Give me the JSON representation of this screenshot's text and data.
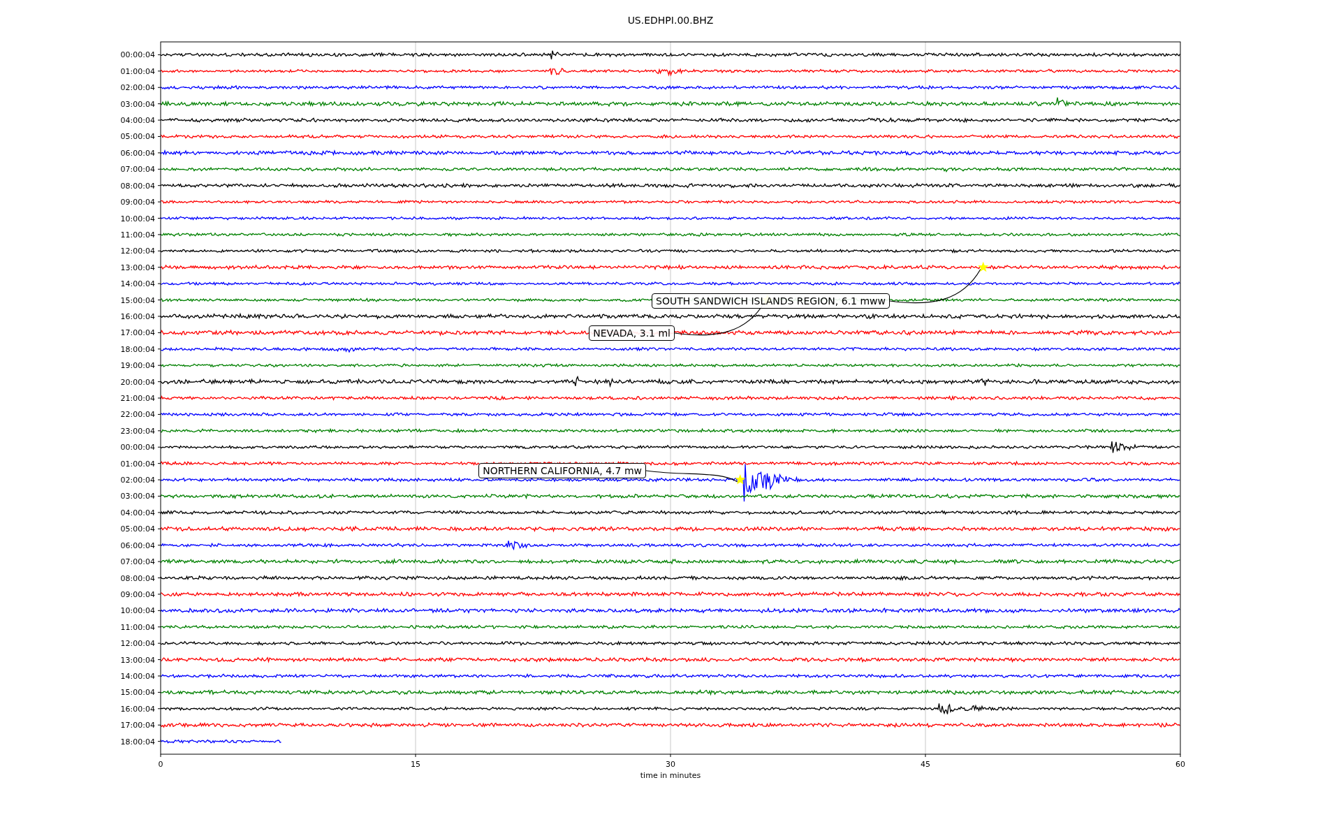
{
  "title": "US.EDHPI.00.BHZ",
  "xlabel": "time in minutes",
  "xticks": [
    "0",
    "15",
    "30",
    "45",
    "60"
  ],
  "rows": [
    {
      "label": "00:00:04",
      "color": "#000000"
    },
    {
      "label": "01:00:04",
      "color": "#ff0000"
    },
    {
      "label": "02:00:04",
      "color": "#0000ff"
    },
    {
      "label": "03:00:04",
      "color": "#008000"
    },
    {
      "label": "04:00:04",
      "color": "#000000"
    },
    {
      "label": "05:00:04",
      "color": "#ff0000"
    },
    {
      "label": "06:00:04",
      "color": "#0000ff"
    },
    {
      "label": "07:00:04",
      "color": "#008000"
    },
    {
      "label": "08:00:04",
      "color": "#000000"
    },
    {
      "label": "09:00:04",
      "color": "#ff0000"
    },
    {
      "label": "10:00:04",
      "color": "#0000ff"
    },
    {
      "label": "11:00:04",
      "color": "#008000"
    },
    {
      "label": "12:00:04",
      "color": "#000000"
    },
    {
      "label": "13:00:04",
      "color": "#ff0000"
    },
    {
      "label": "14:00:04",
      "color": "#0000ff"
    },
    {
      "label": "15:00:04",
      "color": "#008000"
    },
    {
      "label": "16:00:04",
      "color": "#000000"
    },
    {
      "label": "17:00:04",
      "color": "#ff0000"
    },
    {
      "label": "18:00:04",
      "color": "#0000ff"
    },
    {
      "label": "19:00:04",
      "color": "#008000"
    },
    {
      "label": "20:00:04",
      "color": "#000000"
    },
    {
      "label": "21:00:04",
      "color": "#ff0000"
    },
    {
      "label": "22:00:04",
      "color": "#0000ff"
    },
    {
      "label": "23:00:04",
      "color": "#008000"
    },
    {
      "label": "00:00:04",
      "color": "#000000"
    },
    {
      "label": "01:00:04",
      "color": "#ff0000"
    },
    {
      "label": "02:00:04",
      "color": "#0000ff"
    },
    {
      "label": "03:00:04",
      "color": "#008000"
    },
    {
      "label": "04:00:04",
      "color": "#000000"
    },
    {
      "label": "05:00:04",
      "color": "#ff0000"
    },
    {
      "label": "06:00:04",
      "color": "#0000ff"
    },
    {
      "label": "07:00:04",
      "color": "#008000"
    },
    {
      "label": "08:00:04",
      "color": "#000000"
    },
    {
      "label": "09:00:04",
      "color": "#ff0000"
    },
    {
      "label": "10:00:04",
      "color": "#0000ff"
    },
    {
      "label": "11:00:04",
      "color": "#008000"
    },
    {
      "label": "12:00:04",
      "color": "#000000"
    },
    {
      "label": "13:00:04",
      "color": "#ff0000"
    },
    {
      "label": "14:00:04",
      "color": "#0000ff"
    },
    {
      "label": "15:00:04",
      "color": "#008000"
    },
    {
      "label": "16:00:04",
      "color": "#000000"
    },
    {
      "label": "17:00:04",
      "color": "#ff0000"
    },
    {
      "label": "18:00:04",
      "color": "#0000ff"
    }
  ],
  "annotations": [
    {
      "text": "SOUTH SANDWICH ISLANDS REGION, 6.1 mww"
    },
    {
      "text": "NEVADA, 3.1 ml"
    },
    {
      "text": "NORTHERN CALIFORNIA, 4.7 mw"
    }
  ]
}
